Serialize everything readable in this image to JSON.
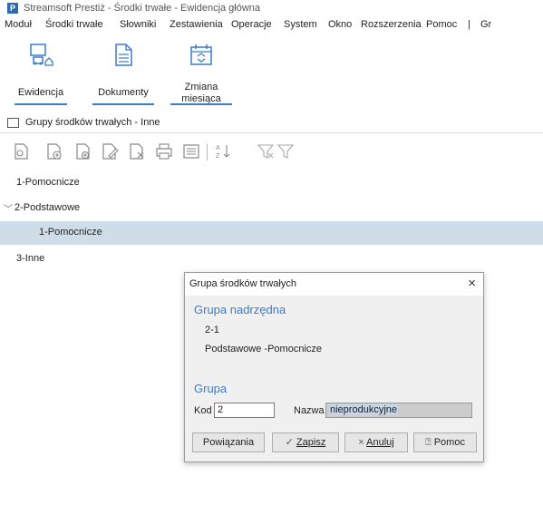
{
  "window": {
    "title": "Streamsoft Prestiż - Środki trwałe - Ewidencja główna",
    "logo_letter": "P"
  },
  "menu": {
    "items": [
      "Moduł",
      "Środki trwałe",
      "Słowniki",
      "Zestawienia",
      "Operacje",
      "System",
      "Okno",
      "Rozszerzenia",
      "Pomoc",
      "|",
      "Gr"
    ]
  },
  "ribbon": {
    "buttons": [
      {
        "label": "Ewidencja",
        "icon": "computer-building-icon"
      },
      {
        "label": "Dokumenty",
        "icon": "document-icon"
      },
      {
        "label_line1": "Zmiana",
        "label_line2": "miesiąca",
        "icon": "calendar-switch-icon"
      }
    ]
  },
  "list": {
    "header": "Grupy środków trwałych - Inne",
    "toolbar_icons": [
      "view-document-icon",
      "add-document-icon",
      "copy-document-icon",
      "edit-document-icon",
      "delete-document-icon",
      "print-icon",
      "list-icon",
      "sort-icon",
      "filter-clear-icon",
      "filter-icon"
    ]
  },
  "tree": {
    "rows": [
      {
        "label": "1-Pomocnicze"
      },
      {
        "label": "2-Podstawowe",
        "expanded": true
      },
      {
        "label": "1-Pomocnicze",
        "selected": true
      },
      {
        "label": "3-Inne"
      }
    ]
  },
  "dialog": {
    "title": "Grupa środków trwałych",
    "close": "×",
    "parent_section": "Grupa nadrzędna",
    "parent_code": "2-1",
    "parent_name": "Podstawowe -Pomocnicze",
    "group_section": "Grupa",
    "kod_label": "Kod",
    "kod_value": "2",
    "nazwa_label": "Nazwa",
    "nazwa_value": "nieprodukcyjne",
    "buttons": {
      "links": "Powiązania",
      "save": "Zapisz",
      "cancel": "Anuluj",
      "help": "Pomoc"
    }
  },
  "colors": {
    "accent": "#3b7ccb",
    "selected_row": "#cfdde8"
  }
}
